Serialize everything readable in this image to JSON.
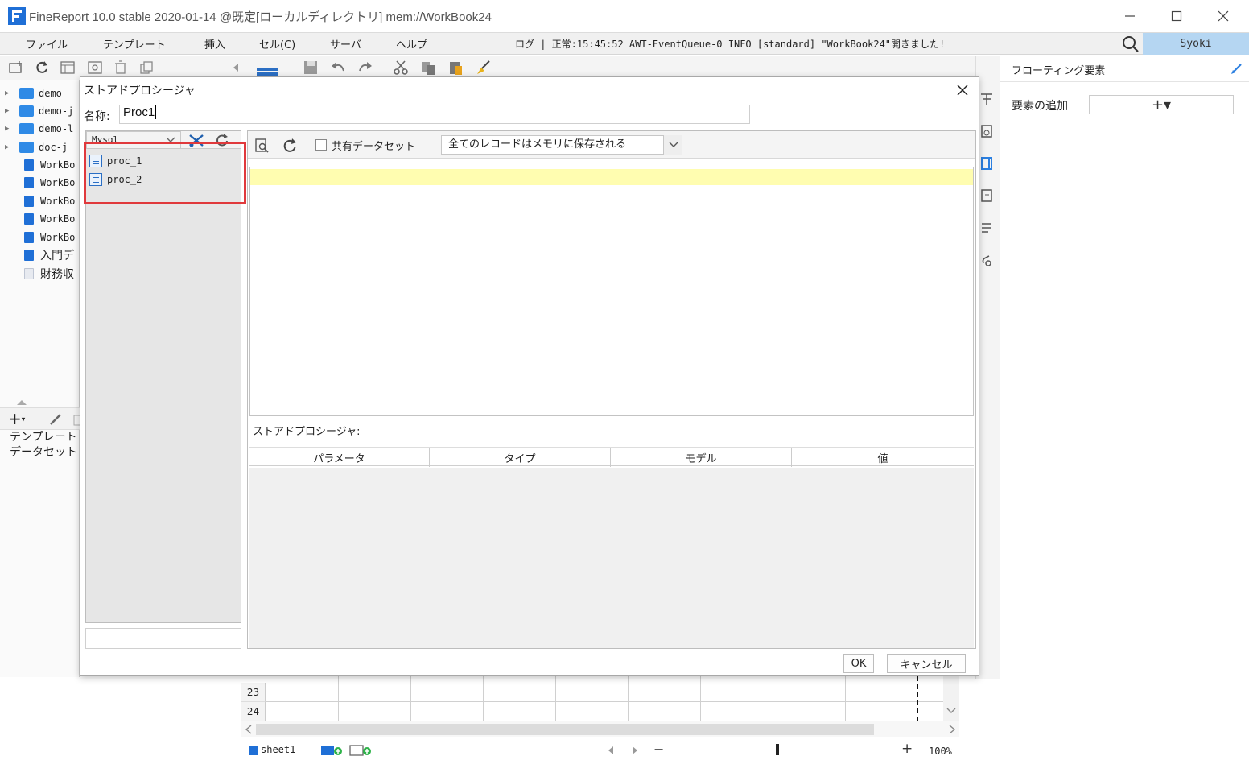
{
  "window": {
    "title": "FineReport 10.0 stable 2020-01-14 @既定[ローカルディレクトリ]   mem://WorkBook24"
  },
  "menu": {
    "items": [
      "ファイル",
      "テンプレート",
      "挿入",
      "セル(C)",
      "サーバ",
      "ヘルプ"
    ],
    "log": "ログ | 正常:15:45:52 AWT-EventQueue-0 INFO [standard] \"WorkBook24\"開きました!",
    "user": "Syoki"
  },
  "tree": {
    "folders": [
      "demo",
      "demo-j",
      "demo-l",
      "doc-j"
    ],
    "files": [
      "WorkBo",
      "WorkBo",
      "WorkBo",
      "WorkBo",
      "WorkBo",
      "入門デ",
      "財務収"
    ]
  },
  "left_bottom": {
    "template_label": "テンプレート",
    "dataset_label": "データセット"
  },
  "right_panel": {
    "title": "フローティング要素",
    "add_label": "要素の追加",
    "add_button": "+▾"
  },
  "dialog": {
    "title": "ストアドプロシージャ",
    "name_label": "名称:",
    "name_value": "Proc1",
    "db_connection": "Mysql",
    "procedures": [
      "proc_1",
      "proc_2"
    ],
    "shared_dataset_label": "共有データセット",
    "shared_dataset_checked": false,
    "memory_option": "全てのレコードはメモリに保存される",
    "proc_section_label": "ストアドプロシージャ:",
    "param_columns": [
      "パラメータ",
      "タイプ",
      "モデル",
      "値"
    ],
    "ok_label": "OK",
    "cancel_label": "キャンセル"
  },
  "sheet": {
    "rows": [
      "23",
      "24"
    ],
    "tab": "sheet1",
    "zoom": "100%"
  },
  "colors": {
    "highlight": "#e0393c",
    "sql_line": "#fffdb0",
    "user_badge": "#b5d6f2",
    "brand": "#1f6fd6"
  }
}
